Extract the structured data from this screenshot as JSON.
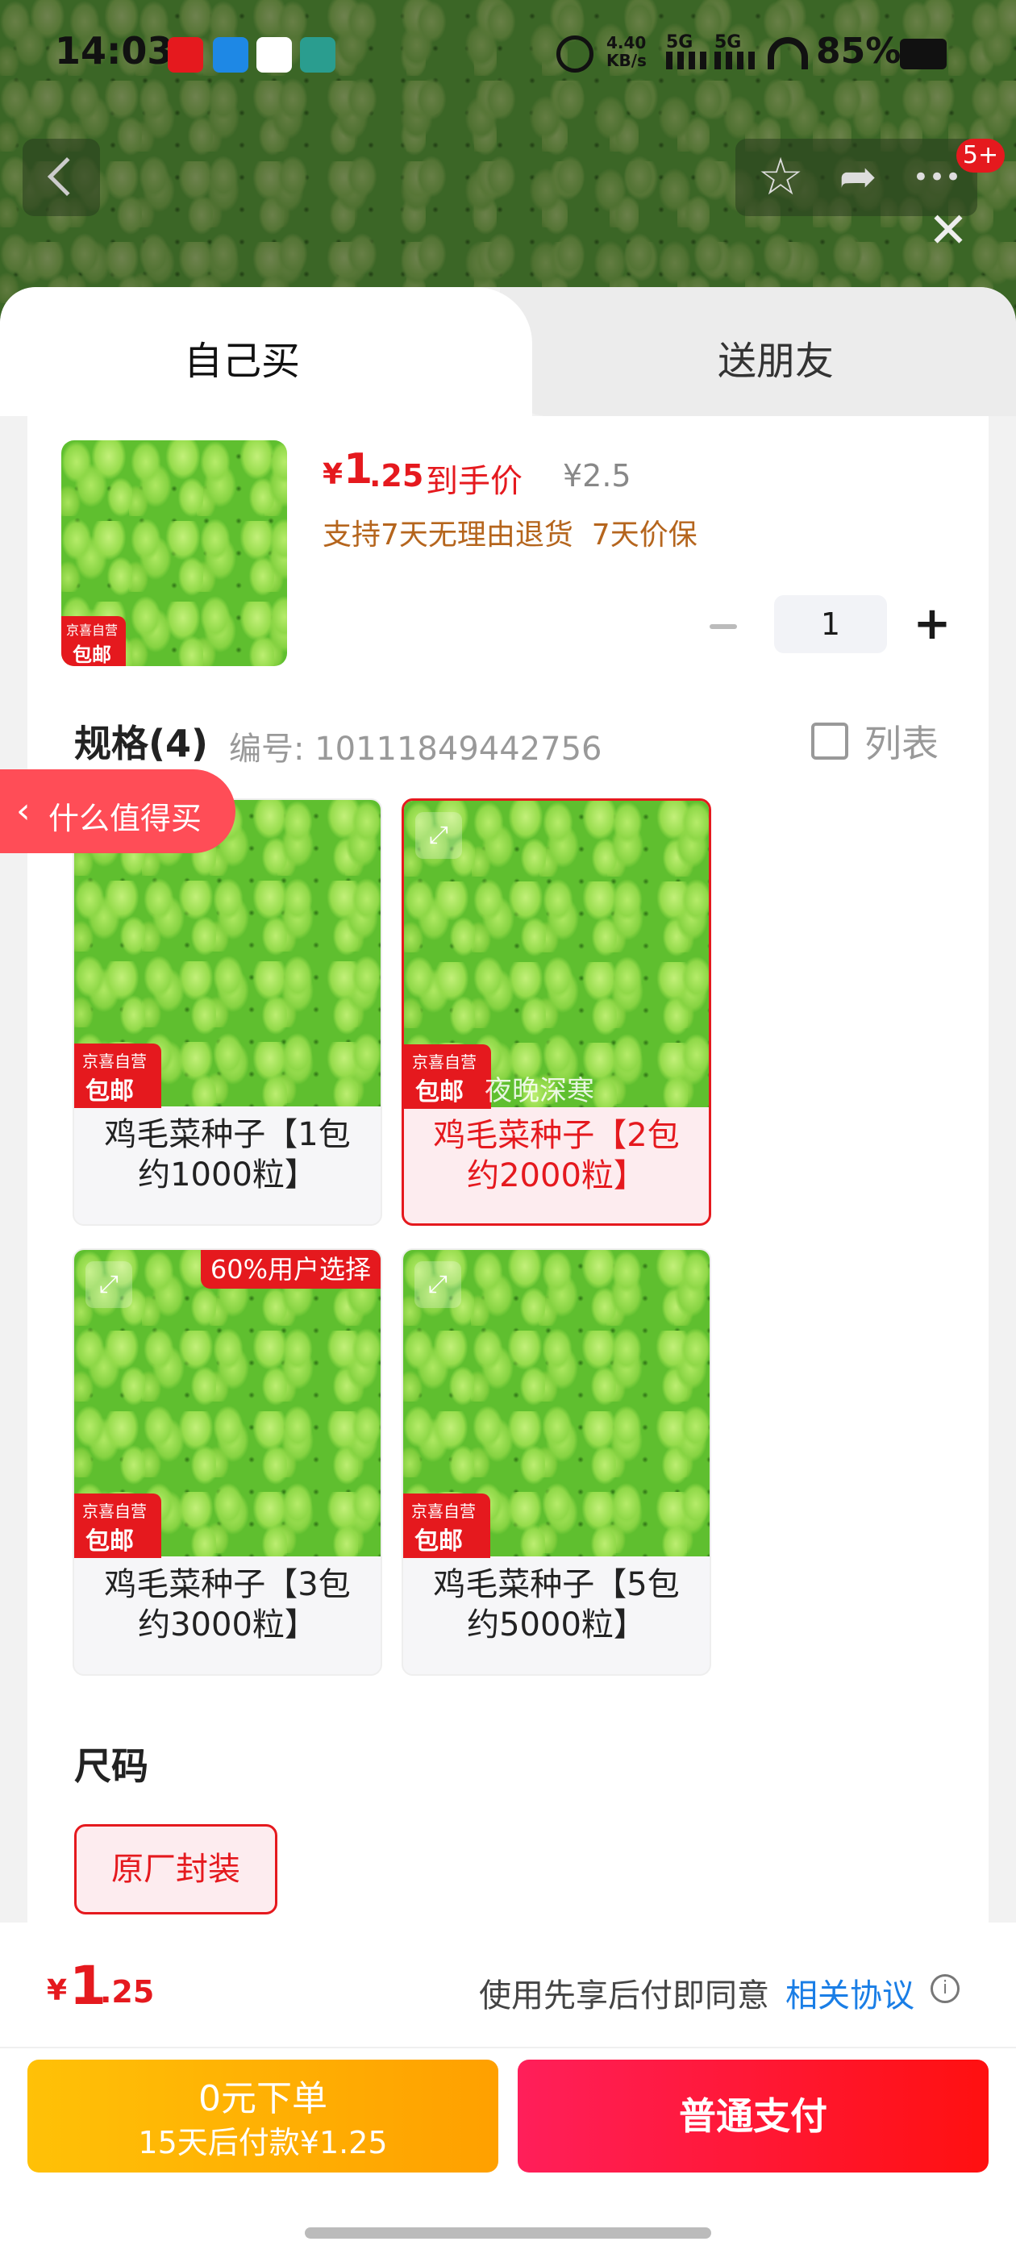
{
  "status": {
    "time": "14:03",
    "net_speed": "4.40 KB/s",
    "sig1": "5G",
    "sig2": "5G",
    "battery": "85%"
  },
  "nav": {
    "badge": "5+",
    "more": "•••"
  },
  "tabs": {
    "self": "自己买",
    "friend": "送朋友"
  },
  "product": {
    "currency": "¥",
    "price_int": "1",
    "price_dec": ".25",
    "price_label": "到手价",
    "orig_price": "¥2.5",
    "service": "支持7天无理由退货  7天价保",
    "thumb_badge_top": "京喜自营",
    "thumb_badge_bottom": "包邮",
    "quantity": "1"
  },
  "spec": {
    "title": "规格(4)",
    "code": "编号: 10111849442756",
    "list_label": "列表",
    "options": [
      {
        "label": "鸡毛菜种子【1包约1000粒】",
        "badge_top": "京喜自营",
        "badge_bottom": "包邮",
        "tag": ""
      },
      {
        "label": "鸡毛菜种子【2包约2000粒】",
        "badge_top": "京喜自营",
        "badge_bottom": "包邮",
        "tag": "",
        "overlay": "夜晚深寒"
      },
      {
        "label": "鸡毛菜种子【3包约3000粒】",
        "badge_top": "京喜自营",
        "badge_bottom": "包邮",
        "tag": "60%用户选择"
      },
      {
        "label": "鸡毛菜种子【5包约5000粒】",
        "badge_top": "京喜自营",
        "badge_bottom": "包邮",
        "tag": ""
      }
    ]
  },
  "float_tag": "什么值得买",
  "size": {
    "title": "尺码",
    "option": "原厂封装"
  },
  "footer": {
    "currency": "¥",
    "price_int": "1",
    "price_dec": ".25",
    "agree_text": "使用先享后付即同意",
    "agree_link": "相关协议",
    "btn_bnpl_main": "0元下单",
    "btn_bnpl_sub": "15天后付款¥1.25",
    "btn_pay": "普通支付"
  },
  "colors": {
    "accent": "#e5191e",
    "bnpl": "#ffb300",
    "pay": "#ff1744"
  }
}
